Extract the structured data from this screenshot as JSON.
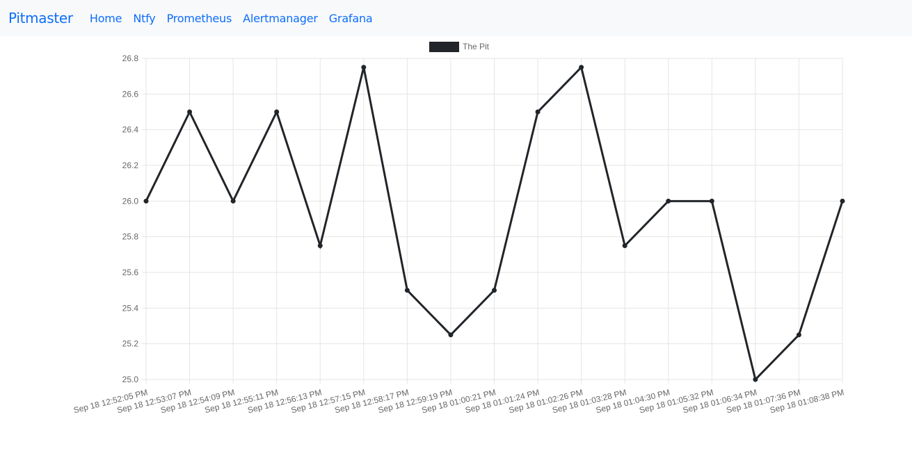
{
  "navbar": {
    "brand": "Pitmaster",
    "links": [
      {
        "label": "Home"
      },
      {
        "label": "Ntfy"
      },
      {
        "label": "Prometheus"
      },
      {
        "label": "Alertmanager"
      },
      {
        "label": "Grafana"
      }
    ]
  },
  "colors": {
    "brand": "#0d6efd",
    "navbar_bg": "#f8f9fa",
    "series": "#212529",
    "grid": "#e5e5e5",
    "tick_text": "#666666"
  },
  "chart_data": {
    "type": "line",
    "x": [
      "Sep 18 12:52:05 PM",
      "Sep 18 12:53:07 PM",
      "Sep 18 12:54:09 PM",
      "Sep 18 12:55:11 PM",
      "Sep 18 12:56:13 PM",
      "Sep 18 12:57:15 PM",
      "Sep 18 12:58:17 PM",
      "Sep 18 12:59:19 PM",
      "Sep 18 01:00:21 PM",
      "Sep 18 01:01:24 PM",
      "Sep 18 01:02:26 PM",
      "Sep 18 01:03:28 PM",
      "Sep 18 01:04:30 PM",
      "Sep 18 01:05:32 PM",
      "Sep 18 01:06:34 PM",
      "Sep 18 01:07:36 PM",
      "Sep 18 01:08:38 PM"
    ],
    "series": [
      {
        "name": "The Pit",
        "values": [
          26.0,
          26.5,
          26.0,
          26.5,
          25.75,
          26.75,
          25.5,
          25.25,
          25.5,
          26.5,
          26.75,
          25.75,
          26.0,
          26.0,
          25.0,
          25.25,
          26.0
        ]
      }
    ],
    "ylim": [
      25.0,
      26.8
    ],
    "yticks": [
      "26.8",
      "26.6",
      "26.4",
      "26.2",
      "26.0",
      "25.8",
      "25.6",
      "25.4",
      "25.2",
      "25.0"
    ],
    "legend": "top-center",
    "grid": true
  }
}
